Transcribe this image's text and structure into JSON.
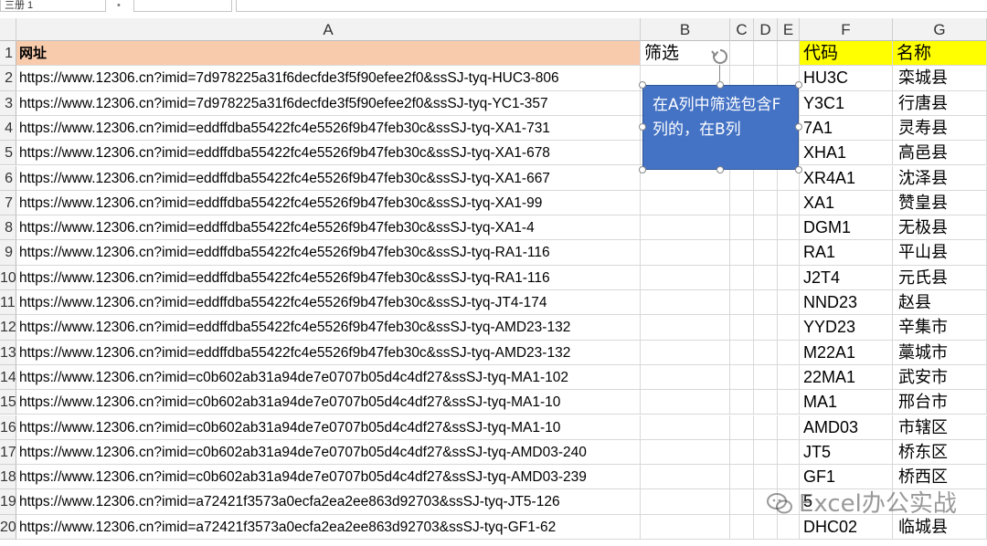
{
  "formula_bar": {
    "name_box": "三册 1",
    "sep": "•",
    "fx": "",
    "formula": ""
  },
  "columns": [
    "A",
    "B",
    "C",
    "D",
    "E",
    "F",
    "G"
  ],
  "header_row": {
    "num": "1",
    "a": "网址",
    "b": "筛选",
    "f": "代码",
    "g": "名称"
  },
  "rows": [
    {
      "num": "2",
      "url": "https://www.12306.cn?imid=7d978225a31f6decfde3f5f90efee2f0&ssSJ-tyq-HUC3-806",
      "code": "HU3C",
      "name": "栾城县"
    },
    {
      "num": "3",
      "url": "https://www.12306.cn?imid=7d978225a31f6decfde3f5f90efee2f0&ssSJ-tyq-YC1-357",
      "code": "Y3C1",
      "name": "行唐县"
    },
    {
      "num": "4",
      "url": "https://www.12306.cn?imid=eddffdba55422fc4e5526f9b47feb30c&ssSJ-tyq-XA1-731",
      "code": "7A1",
      "name": "灵寿县"
    },
    {
      "num": "5",
      "url": "https://www.12306.cn?imid=eddffdba55422fc4e5526f9b47feb30c&ssSJ-tyq-XA1-678",
      "code": "XHA1",
      "name": "高邑县"
    },
    {
      "num": "6",
      "url": "https://www.12306.cn?imid=eddffdba55422fc4e5526f9b47feb30c&ssSJ-tyq-XA1-667",
      "code": "XR4A1",
      "name": "沈泽县"
    },
    {
      "num": "7",
      "url": "https://www.12306.cn?imid=eddffdba55422fc4e5526f9b47feb30c&ssSJ-tyq-XA1-99",
      "code": "XA1",
      "name": "赞皇县"
    },
    {
      "num": "8",
      "url": "https://www.12306.cn?imid=eddffdba55422fc4e5526f9b47feb30c&ssSJ-tyq-XA1-4",
      "code": "DGM1",
      "name": "无极县"
    },
    {
      "num": "9",
      "url": "https://www.12306.cn?imid=eddffdba55422fc4e5526f9b47feb30c&ssSJ-tyq-RA1-116",
      "code": "RA1",
      "name": "平山县"
    },
    {
      "num": "10",
      "url": "https://www.12306.cn?imid=eddffdba55422fc4e5526f9b47feb30c&ssSJ-tyq-RA1-116",
      "code": "J2T4",
      "name": "元氏县"
    },
    {
      "num": "11",
      "url": "https://www.12306.cn?imid=eddffdba55422fc4e5526f9b47feb30c&ssSJ-tyq-JT4-174",
      "code": "NND23",
      "name": "赵县"
    },
    {
      "num": "12",
      "url": "https://www.12306.cn?imid=eddffdba55422fc4e5526f9b47feb30c&ssSJ-tyq-AMD23-132",
      "code": "YYD23",
      "name": "辛集市"
    },
    {
      "num": "13",
      "url": "https://www.12306.cn?imid=eddffdba55422fc4e5526f9b47feb30c&ssSJ-tyq-AMD23-132",
      "code": "M22A1",
      "name": "藁城市"
    },
    {
      "num": "14",
      "url": "https://www.12306.cn?imid=c0b602ab31a94de7e0707b05d4c4df27&ssSJ-tyq-MA1-102",
      "code": "22MA1",
      "name": "武安市"
    },
    {
      "num": "15",
      "url": "https://www.12306.cn?imid=c0b602ab31a94de7e0707b05d4c4df27&ssSJ-tyq-MA1-10",
      "code": "MA1",
      "name": "邢台市"
    },
    {
      "num": "16",
      "url": "https://www.12306.cn?imid=c0b602ab31a94de7e0707b05d4c4df27&ssSJ-tyq-MA1-10",
      "code": "AMD03",
      "name": "市辖区"
    },
    {
      "num": "17",
      "url": "https://www.12306.cn?imid=c0b602ab31a94de7e0707b05d4c4df27&ssSJ-tyq-AMD03-240",
      "code": "JT5",
      "name": "桥东区"
    },
    {
      "num": "18",
      "url": "https://www.12306.cn?imid=c0b602ab31a94de7e0707b05d4c4df27&ssSJ-tyq-AMD03-239",
      "code": "GF1",
      "name": "桥西区"
    },
    {
      "num": "19",
      "url": "https://www.12306.cn?imid=a72421f3573a0ecfa2ea2ee863d92703&ssSJ-tyq-JT5-126",
      "code": "5",
      "name": ""
    },
    {
      "num": "20",
      "url": "https://www.12306.cn?imid=a72421f3573a0ecfa2ea2ee863d92703&ssSJ-tyq-GF1-62",
      "code": "DHC02",
      "name": "临城县"
    }
  ],
  "shape_text": "在A列中筛选包含F列的，在B列",
  "watermark": "Excel办公实战",
  "colors": {
    "header_orange": "#f8cbad",
    "header_yellow": "#ffff00",
    "shape_blue": "#4472c4"
  }
}
